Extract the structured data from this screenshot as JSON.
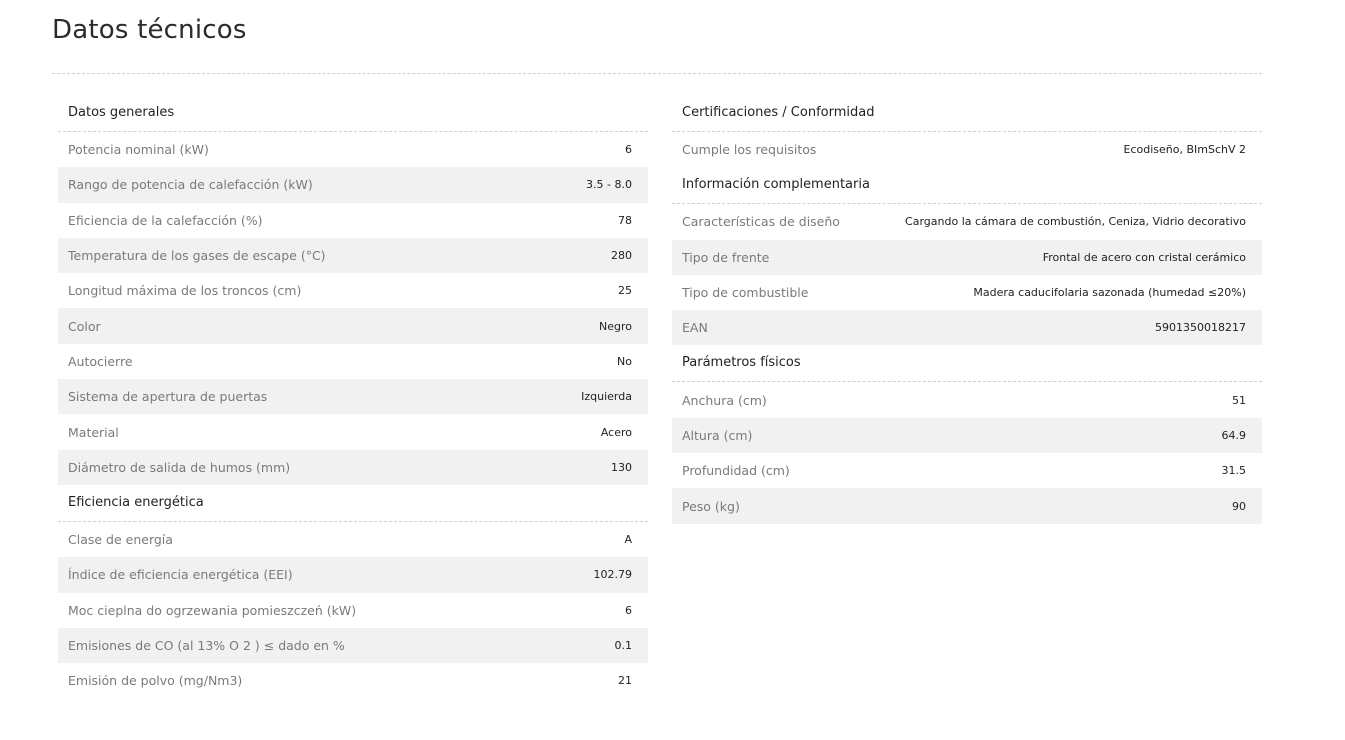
{
  "page_title": "Datos técnicos",
  "left_sections": [
    {
      "title": "Datos generales",
      "rows": [
        {
          "label": "Potencia nominal (kW)",
          "value": "6"
        },
        {
          "label": "Rango de potencia de calefacción (kW)",
          "value": "3.5 - 8.0"
        },
        {
          "label": "Eficiencia de la calefacción (%)",
          "value": "78"
        },
        {
          "label": "Temperatura de los gases de escape (°C)",
          "value": "280"
        },
        {
          "label": "Longitud máxima de los troncos (cm)",
          "value": "25"
        },
        {
          "label": "Color",
          "value": "Negro"
        },
        {
          "label": "Autocierre",
          "value": "No"
        },
        {
          "label": "Sistema de apertura de puertas",
          "value": "Izquierda"
        },
        {
          "label": "Material",
          "value": "Acero"
        },
        {
          "label": "Diámetro de salida de humos (mm)",
          "value": "130"
        }
      ]
    },
    {
      "title": "Eficiencia energética",
      "rows": [
        {
          "label": "Clase de energía",
          "value": "A"
        },
        {
          "label": "Índice de eficiencia energética (EEI)",
          "value": "102.79"
        },
        {
          "label": "Moc cieplna do ogrzewania pomieszczeń (kW)",
          "value": "6"
        },
        {
          "label": "Emisiones de CO (al 13% O 2 ) ≤ dado en %",
          "value": "0.1"
        },
        {
          "label": "Emisión de polvo (mg/Nm3)",
          "value": "21"
        }
      ]
    }
  ],
  "right_sections": [
    {
      "title": "Certificaciones / Conformidad",
      "rows": [
        {
          "label": "Cumple los requisitos",
          "value": "Ecodiseño, BImSchV 2"
        }
      ]
    },
    {
      "title": "Información complementaria",
      "rows": [
        {
          "label": "Características de diseño",
          "value": "Cargando la cámara de combustión, Ceniza, Vidrio decorativo"
        },
        {
          "label": "Tipo de frente",
          "value": "Frontal de acero con cristal cerámico"
        },
        {
          "label": "Tipo de combustible",
          "value": "Madera caducifolaria sazonada (humedad ≤20%)"
        },
        {
          "label": "EAN",
          "value": "5901350018217"
        }
      ]
    },
    {
      "title": "Parámetros físicos",
      "rows": [
        {
          "label": "Anchura (cm)",
          "value": "51"
        },
        {
          "label": "Altura (cm)",
          "value": "64.9"
        },
        {
          "label": "Profundidad (cm)",
          "value": "31.5"
        },
        {
          "label": "Peso (kg)",
          "value": "90"
        }
      ]
    }
  ]
}
